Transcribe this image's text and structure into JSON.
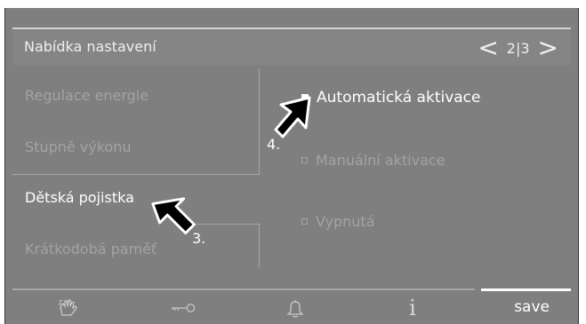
{
  "header": {
    "title": "Nabídka nastavení",
    "prev_arrow": "<",
    "next_arrow": ">",
    "page": "2|3"
  },
  "menu": {
    "items": [
      {
        "label": "Regulace energie",
        "active": false
      },
      {
        "label": "Stupně výkonu",
        "active": false
      },
      {
        "label": "Dětská pojistka",
        "active": true
      },
      {
        "label": "Krátkodobá paměť",
        "active": false
      }
    ]
  },
  "options": {
    "items": [
      {
        "label": "Automatická aktivace",
        "selected": true
      },
      {
        "label": "Manuální aktivace",
        "selected": false
      },
      {
        "label": "Vypnutá",
        "selected": false
      }
    ]
  },
  "annotations": {
    "step3": "3.",
    "step4": "4."
  },
  "footer": {
    "icons": [
      "hand-wipe-icon",
      "key-icon",
      "bell-icon",
      "info-icon"
    ],
    "info_glyph": "i",
    "save_label": "save"
  },
  "colors": {
    "screen_bg": "#7f7f7f",
    "active_text": "#ffffff",
    "inactive_text": "#a3a3a3"
  }
}
